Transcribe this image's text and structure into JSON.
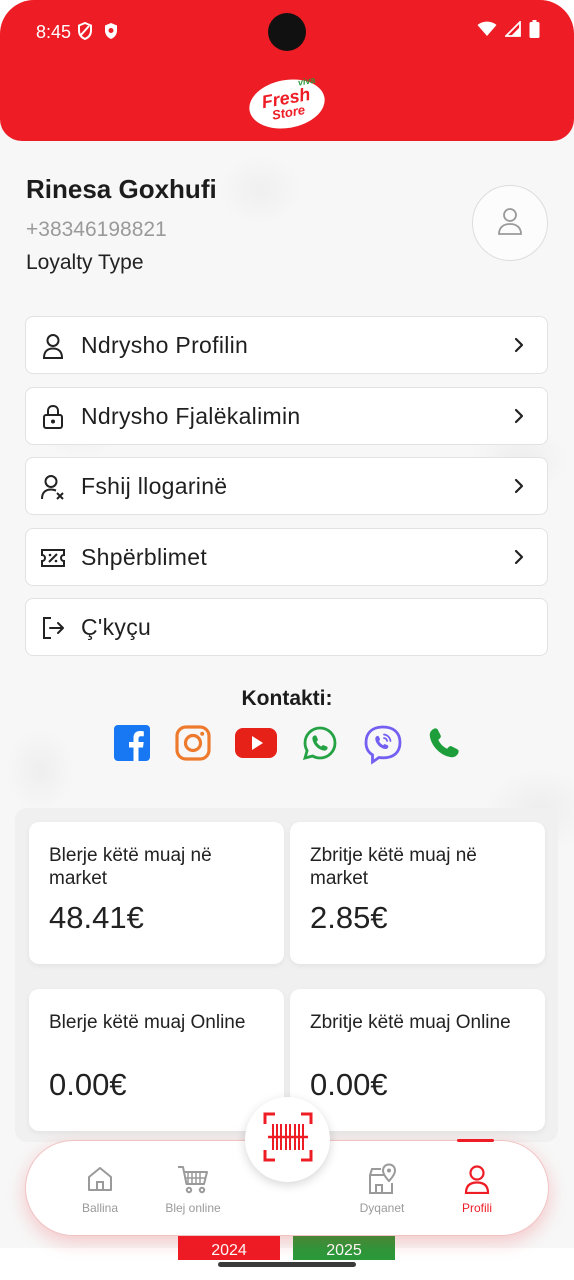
{
  "status_bar": {
    "time": "8:45"
  },
  "header": {
    "logo_top": "viva",
    "logo_main": "Fresh",
    "logo_sub": "Store"
  },
  "profile": {
    "name": "Rinesa Goxhufi",
    "phone": "+38346198821",
    "loyalty": "Loyalty Type"
  },
  "menu": {
    "edit_profile": "Ndrysho Profilin",
    "change_password": "Ndrysho Fjalëkalimin",
    "delete_account": "Fshij llogarinë",
    "rewards": "Shpërblimet",
    "logout": "Ç'kyçu"
  },
  "contact": {
    "title": "Kontakti:",
    "icons": [
      "facebook-icon",
      "instagram-icon",
      "youtube-icon",
      "whatsapp-icon",
      "viber-icon",
      "phone-icon"
    ]
  },
  "stats": [
    {
      "label": "Blerje këtë muaj në market",
      "value": "48.41€"
    },
    {
      "label": "Zbritje këtë muaj në market",
      "value": "2.85€"
    },
    {
      "label": "Blerje këtë muaj Online",
      "value": "0.00€"
    },
    {
      "label": "Zbritje këtë muaj Online",
      "value": "0.00€"
    }
  ],
  "tabs": {
    "home": "Ballina",
    "shop": "Blej online",
    "stores": "Dyqanet",
    "profile": "Profili"
  },
  "years": [
    "2024",
    "2025"
  ],
  "colors": {
    "brand_red": "#ee1c25",
    "brand_green": "#2a9a3a",
    "facebook": "#1877f2",
    "instagram": "#ee7a2e",
    "youtube": "#e62117",
    "whatsapp": "#25a244",
    "viber": "#7360f2",
    "phone": "#1e9e3a"
  }
}
